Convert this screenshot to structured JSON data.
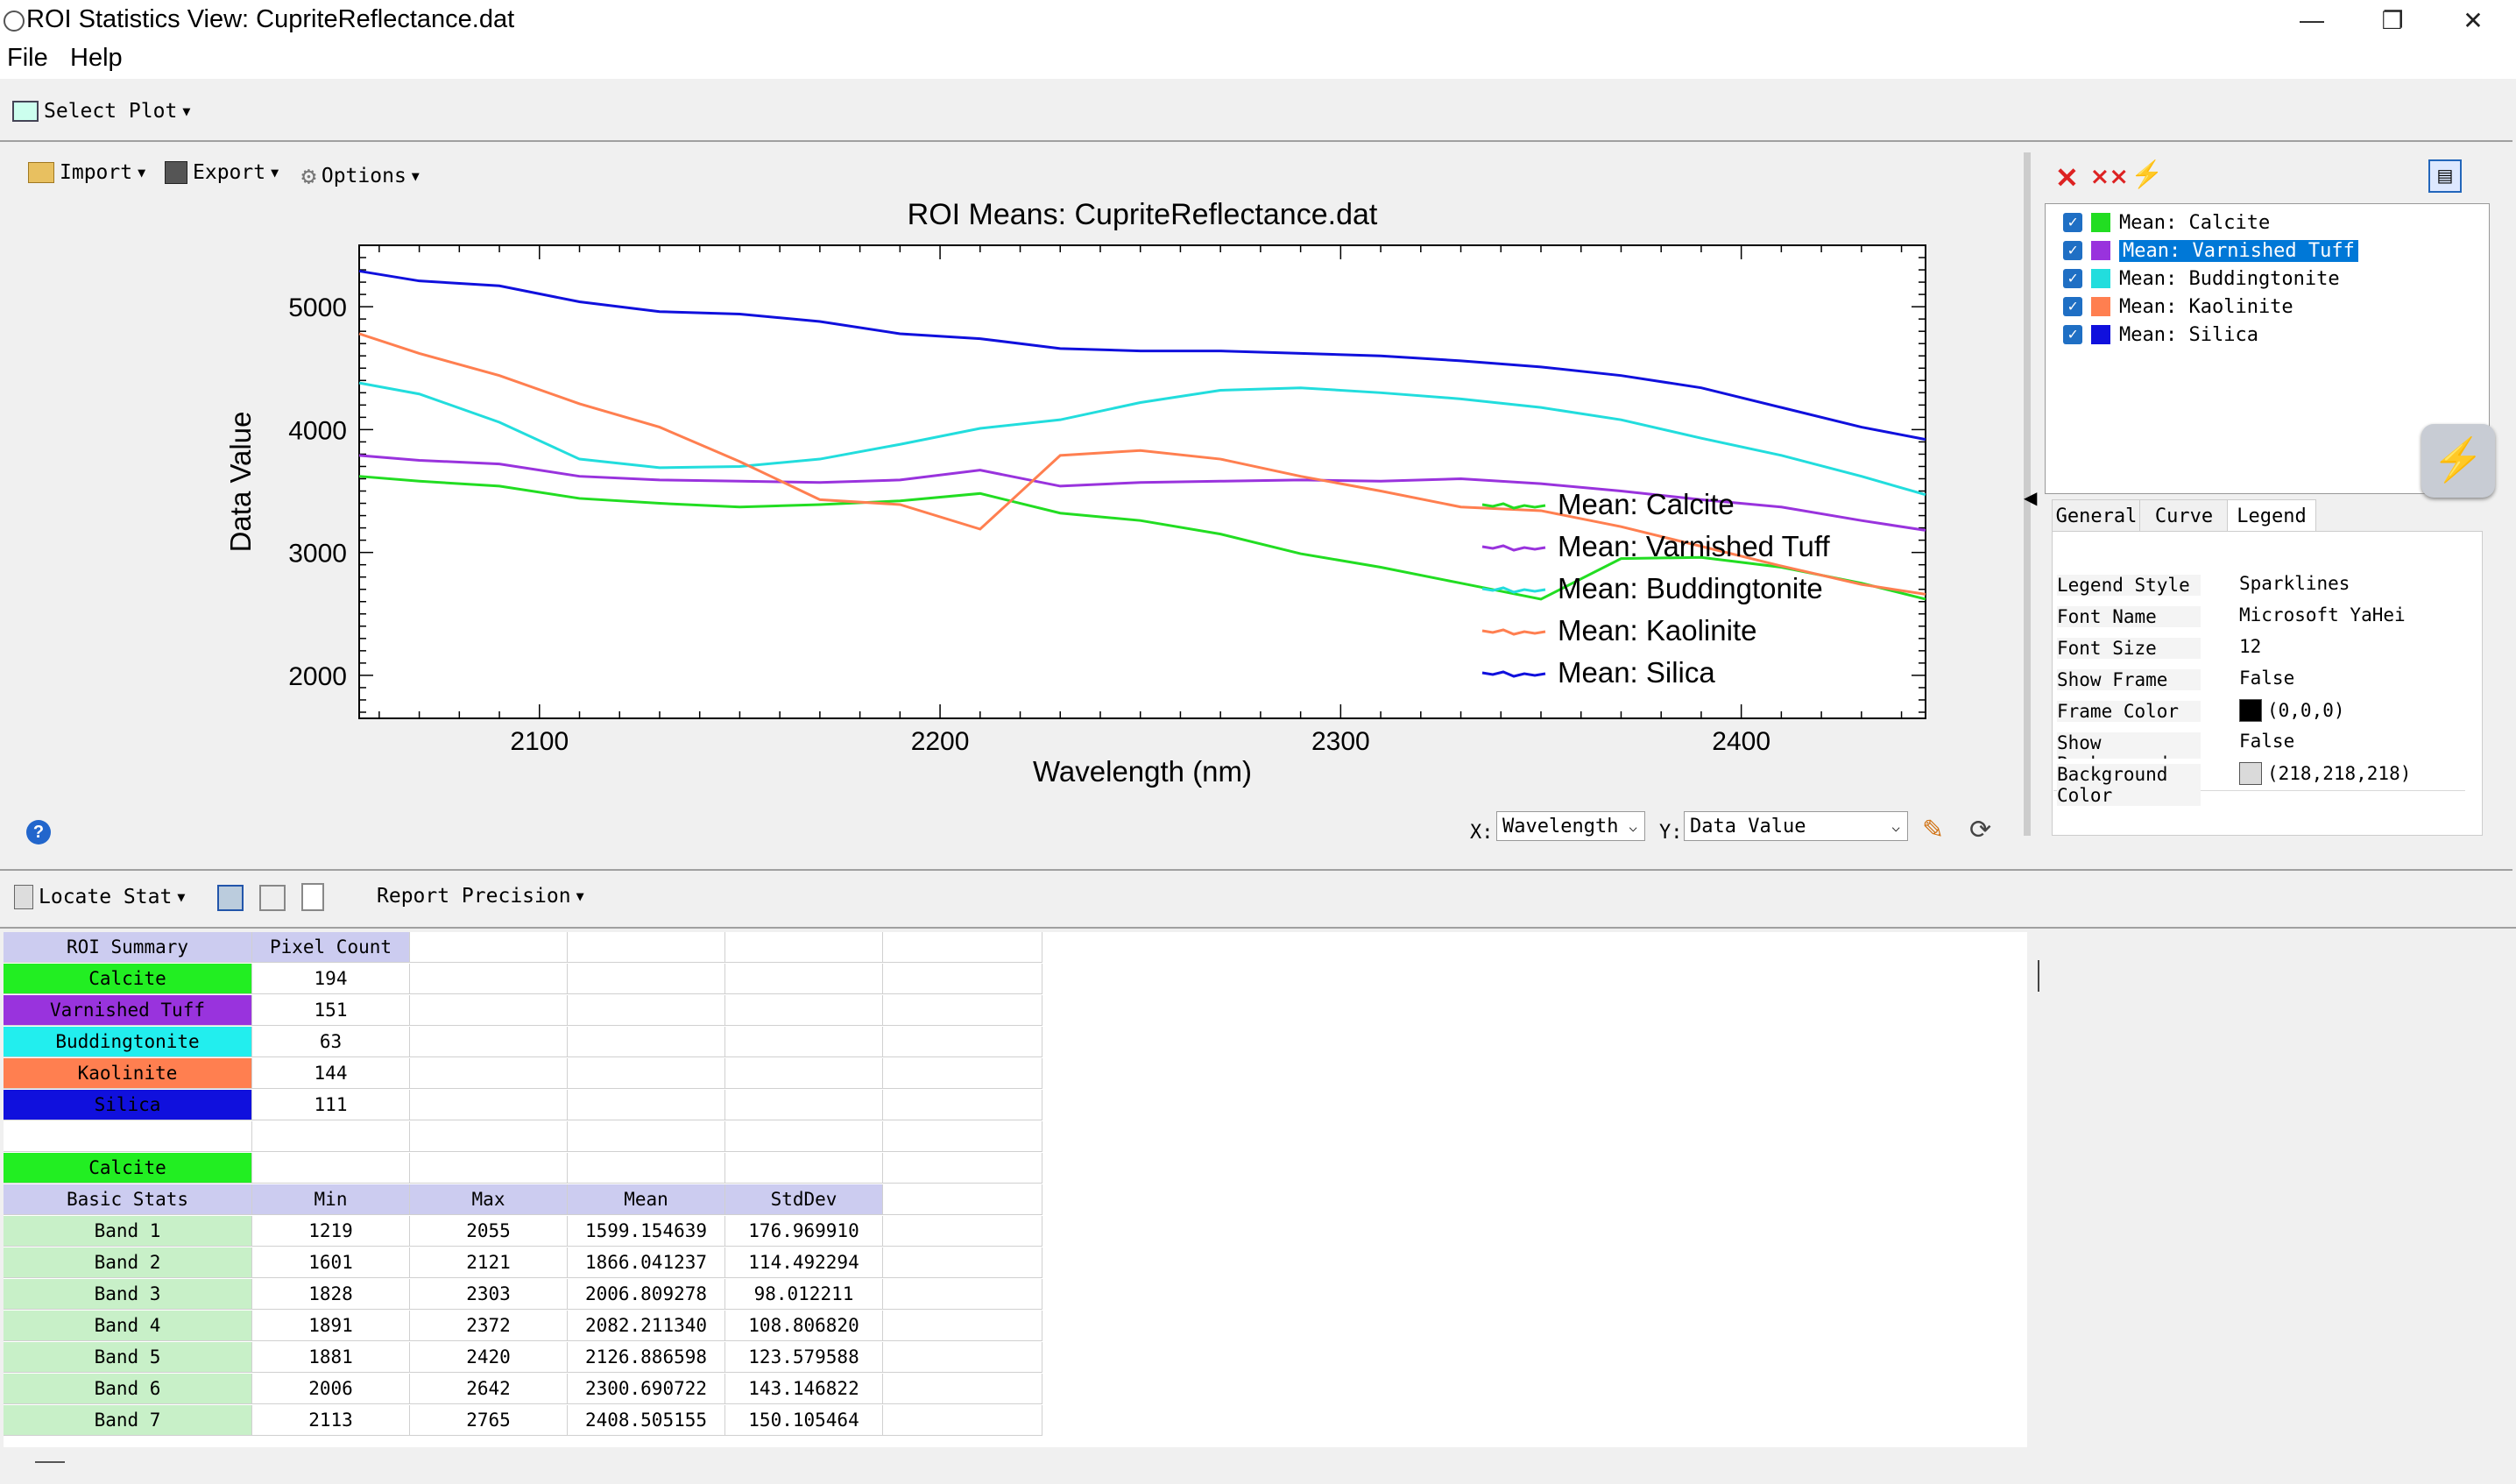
{
  "window": {
    "title": "ROI Statistics View: CupriteReflectance.dat",
    "minimize_glyph": "—",
    "maximize_glyph": "❐",
    "close_glyph": "✕"
  },
  "menu": {
    "file": "File",
    "help": "Help"
  },
  "toolbar": {
    "select_plot": "Select Plot"
  },
  "plot_toolbar": {
    "import": "Import",
    "export": "Export",
    "options": "Options"
  },
  "chart_data": {
    "type": "line",
    "title": "ROI Means: CupriteReflectance.dat",
    "xlabel": "Wavelength (nm)",
    "ylabel": "Data Value",
    "xlim": [
      2055,
      2446
    ],
    "ylim": [
      1650,
      5500
    ],
    "xticks": [
      2100,
      2200,
      2300,
      2400
    ],
    "yticks": [
      2000,
      3000,
      4000,
      5000
    ],
    "grid": false,
    "legend_position": "bottom-right",
    "x": [
      2055,
      2070,
      2090,
      2110,
      2130,
      2150,
      2170,
      2190,
      2210,
      2230,
      2250,
      2270,
      2290,
      2310,
      2330,
      2350,
      2370,
      2390,
      2410,
      2430,
      2446
    ],
    "series": [
      {
        "name": "Mean: Calcite",
        "color": "#22dd22",
        "values": [
          3620,
          3580,
          3540,
          3440,
          3400,
          3370,
          3390,
          3420,
          3480,
          3320,
          3260,
          3150,
          2990,
          2880,
          2750,
          2620,
          2950,
          2960,
          2880,
          2750,
          2620
        ]
      },
      {
        "name": "Mean: Varnished Tuff",
        "color": "#9933dd",
        "values": [
          3790,
          3750,
          3720,
          3620,
          3590,
          3580,
          3570,
          3590,
          3670,
          3540,
          3570,
          3580,
          3590,
          3580,
          3600,
          3560,
          3500,
          3430,
          3370,
          3260,
          3180
        ]
      },
      {
        "name": "Mean: Buddingtonite",
        "color": "#22dddd",
        "values": [
          4380,
          4290,
          4060,
          3760,
          3690,
          3700,
          3760,
          3880,
          4010,
          4080,
          4220,
          4320,
          4340,
          4300,
          4250,
          4180,
          4080,
          3930,
          3790,
          3620,
          3470
        ]
      },
      {
        "name": "Mean: Kaolinite",
        "color": "#ff7f50",
        "values": [
          4780,
          4620,
          4440,
          4210,
          4020,
          3740,
          3430,
          3390,
          3190,
          3790,
          3830,
          3760,
          3620,
          3500,
          3370,
          3340,
          3210,
          3050,
          2890,
          2740,
          2660
        ]
      },
      {
        "name": "Mean: Silica",
        "color": "#1010dd",
        "values": [
          5290,
          5210,
          5170,
          5040,
          4960,
          4940,
          4880,
          4780,
          4740,
          4660,
          4640,
          4640,
          4620,
          4600,
          4560,
          4510,
          4440,
          4340,
          4180,
          4020,
          3920
        ]
      }
    ]
  },
  "axis_selectors": {
    "x_label": "X:",
    "x_value": "Wavelength",
    "y_label": "Y:",
    "y_value": "Data Value"
  },
  "legend_tree": {
    "items": [
      {
        "label": "Mean: Calcite",
        "color": "#22dd22",
        "selected": false
      },
      {
        "label": "Mean: Varnished Tuff",
        "color": "#9933dd",
        "selected": true
      },
      {
        "label": "Mean: Buddingtonite",
        "color": "#22dddd",
        "selected": false
      },
      {
        "label": "Mean: Kaolinite",
        "color": "#ff7f50",
        "selected": false
      },
      {
        "label": "Mean: Silica",
        "color": "#1010dd",
        "selected": false
      }
    ]
  },
  "tabs": {
    "general": "General",
    "curve": "Curve",
    "legend": "Legend"
  },
  "properties": [
    {
      "name": "Legend Style",
      "value": "Sparklines"
    },
    {
      "name": "Font Name",
      "value": "Microsoft YaHei"
    },
    {
      "name": "Font Size",
      "value": "12"
    },
    {
      "name": "Show Frame",
      "value": "False"
    },
    {
      "name": "Frame Color",
      "value": "(0,0,0)",
      "swatch": "#000000"
    },
    {
      "name": "Show Background",
      "value": "False"
    },
    {
      "name": "Background Color",
      "value": "(218,218,218)",
      "swatch": "#dadada"
    }
  ],
  "stats_toolbar": {
    "locate_stat": "Locate Stat",
    "report_precision": "Report Precision"
  },
  "summary": {
    "headers": [
      "ROI Summary",
      "Pixel Count"
    ],
    "rows": [
      {
        "name": "Calcite",
        "count": "194",
        "color": "#22ee22"
      },
      {
        "name": "Varnished Tuff",
        "count": "151",
        "color": "#9933dd"
      },
      {
        "name": "Buddingtonite",
        "count": "63",
        "color": "#22eeee"
      },
      {
        "name": "Kaolinite",
        "count": "144",
        "color": "#ff7f50"
      },
      {
        "name": "Silica",
        "count": "111",
        "color": "#1010dd"
      }
    ]
  },
  "basic_stats": {
    "roi_name": "Calcite",
    "roi_color": "#22ee22",
    "headers": [
      "Basic Stats",
      "Min",
      "Max",
      "Mean",
      "StdDev"
    ],
    "rows": [
      [
        "Band 1",
        "1219",
        "2055",
        "1599.154639",
        "176.969910"
      ],
      [
        "Band 2",
        "1601",
        "2121",
        "1866.041237",
        "114.492294"
      ],
      [
        "Band 3",
        "1828",
        "2303",
        "2006.809278",
        "98.012211"
      ],
      [
        "Band 4",
        "1891",
        "2372",
        "2082.211340",
        "108.806820"
      ],
      [
        "Band 5",
        "1881",
        "2420",
        "2126.886598",
        "123.579588"
      ],
      [
        "Band 6",
        "2006",
        "2642",
        "2300.690722",
        "143.146822"
      ],
      [
        "Band 7",
        "2113",
        "2765",
        "2408.505155",
        "150.105464"
      ]
    ]
  }
}
